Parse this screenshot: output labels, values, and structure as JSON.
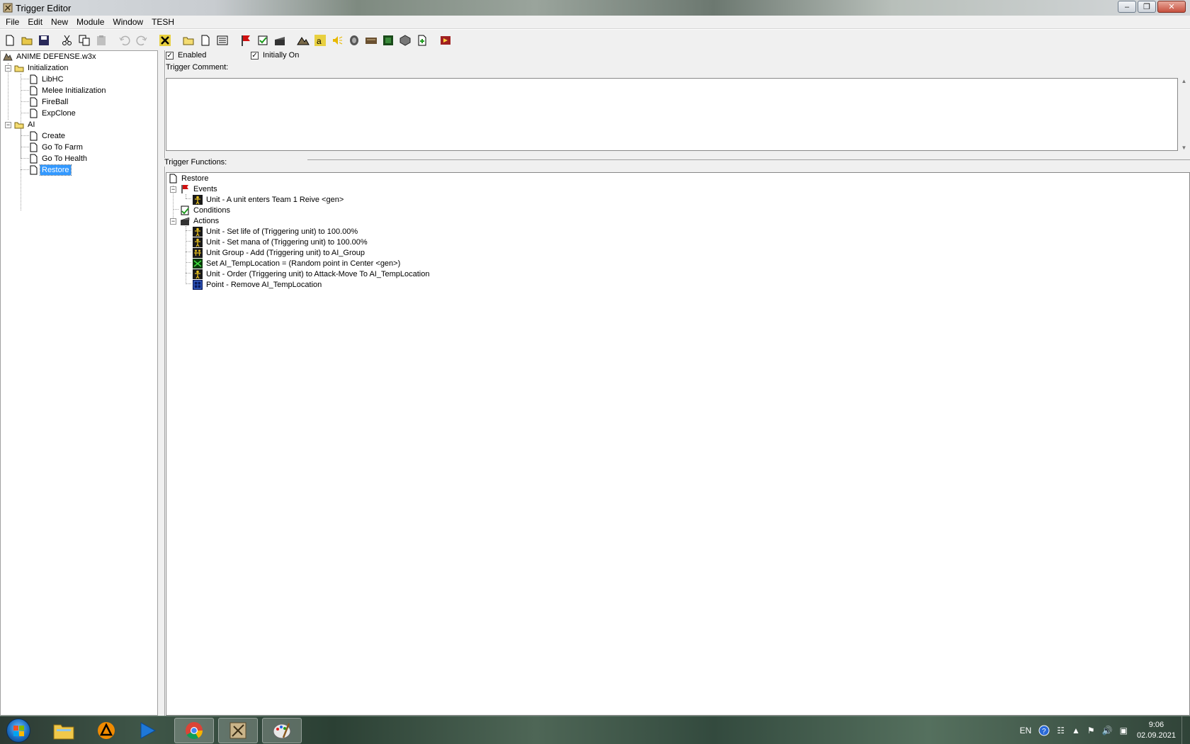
{
  "window": {
    "title": "Trigger Editor"
  },
  "menu": [
    "File",
    "Edit",
    "New",
    "Module",
    "Window",
    "TESH"
  ],
  "toolbar": {
    "icons": [
      "new-icon",
      "open-icon",
      "save-icon",
      "cut-icon",
      "copy-icon",
      "paste-icon",
      "undo-icon",
      "redo-icon",
      "delete-icon",
      "new-category-icon",
      "new-trigger-icon",
      "new-comment-icon",
      "new-event-icon",
      "new-condition-icon",
      "new-action-icon",
      "terrain-editor-icon",
      "trigger-editor-icon",
      "sound-editor-icon",
      "object-editor-icon",
      "campaign-editor-icon",
      "ai-editor-icon",
      "object-manager-icon",
      "import-manager-icon",
      "test-map-icon"
    ]
  },
  "tree": {
    "root": "ANIME DEFENSE.w3x",
    "categories": [
      {
        "name": "Initialization",
        "triggers": [
          "LibHC",
          "Melee Initialization",
          "FireBall",
          "ExpClone"
        ]
      },
      {
        "name": "AI",
        "triggers": [
          "Create",
          "Go To Farm",
          "Go To Health",
          "Restore"
        ]
      }
    ],
    "selected": "Restore"
  },
  "trigger": {
    "enabled_label": "Enabled",
    "enabled": true,
    "initially_on_label": "Initially On",
    "initially_on": true,
    "comment_label": "Trigger Comment:",
    "comment": "",
    "functions_label": "Trigger Functions:"
  },
  "functions": {
    "name": "Restore",
    "events_label": "Events",
    "events": [
      "Unit - A unit enters Team 1 Reive <gen>"
    ],
    "conditions_label": "Conditions",
    "actions_label": "Actions",
    "actions": [
      {
        "text": "Unit - Set life of (Triggering unit) to 100.00%",
        "icon": "unit-icon"
      },
      {
        "text": "Unit - Set mana of (Triggering unit) to 100.00%",
        "icon": "unit-icon"
      },
      {
        "text": "Unit Group - Add (Triggering unit) to AI_Group",
        "icon": "unit-group-icon"
      },
      {
        "text": "Set AI_TempLocation = (Random point in Center <gen>)",
        "icon": "set-variable-icon"
      },
      {
        "text": "Unit - Order (Triggering unit) to Attack-Move To AI_TempLocation",
        "icon": "unit-icon"
      },
      {
        "text": "Point - Remove AI_TempLocation",
        "icon": "point-icon"
      }
    ]
  },
  "taskbar": {
    "lang": "EN",
    "time": "9:06",
    "date": "02.09.2021"
  }
}
